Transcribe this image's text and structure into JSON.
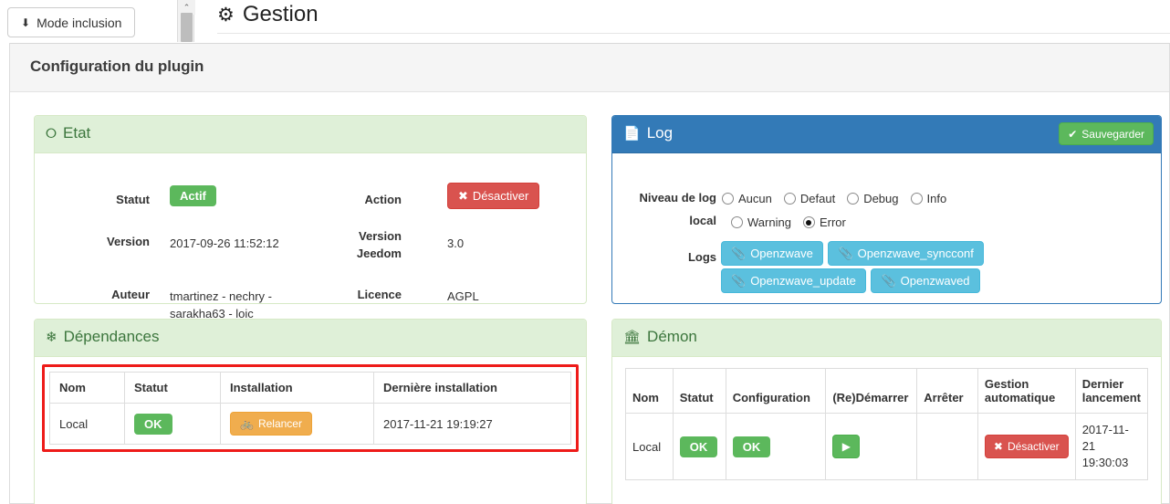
{
  "topbar": {
    "mode_button_label": "Mode inclusion",
    "mode_button_icon": "download-icon",
    "page_heading": "Gestion",
    "page_heading_icon": "gear-icon",
    "scrollbar_arrow": "⌃"
  },
  "panel": {
    "title": "Configuration du plugin"
  },
  "etat": {
    "title": "Etat",
    "icon": "power-circle-icon",
    "labels": {
      "statut": "Statut",
      "action": "Action",
      "version": "Version",
      "version_jeedom": "Version Jeedom",
      "auteur": "Auteur",
      "licence": "Licence"
    },
    "statut_value": "Actif",
    "action_button": "Désactiver",
    "action_button_icon": "times-icon",
    "version_value": "2017-09-26 11:52:12",
    "version_jeedom_value": "3.0",
    "auteur_value": "tmartinez - nechry - sarakha63 - loic",
    "licence_value": "AGPL"
  },
  "log": {
    "title": "Log",
    "icon": "file-icon",
    "save_button": "Sauvegarder",
    "save_button_icon": "check-circle-icon",
    "level_label": "Niveau de log local",
    "levels": [
      {
        "label": "Aucun",
        "checked": false
      },
      {
        "label": "Defaut",
        "checked": false
      },
      {
        "label": "Debug",
        "checked": false
      },
      {
        "label": "Info",
        "checked": false
      },
      {
        "label": "Warning",
        "checked": false
      },
      {
        "label": "Error",
        "checked": true
      }
    ],
    "logs_label": "Logs",
    "log_buttons": [
      "Openzwave",
      "Openzwave_syncconf",
      "Openzwave_update",
      "Openzwaved"
    ],
    "log_button_icon": "paperclip-icon"
  },
  "dependances": {
    "title": "Dépendances",
    "icon": "cubes-icon",
    "columns": [
      "Nom",
      "Statut",
      "Installation",
      "Dernière installation"
    ],
    "rows": [
      {
        "nom": "Local",
        "statut": "OK",
        "installation": "Relancer",
        "installation_icon": "bicycle-icon",
        "derniere_installation": "2017-11-21 19:19:27"
      }
    ],
    "highlighted": true,
    "highlight_color": "#ee1b19"
  },
  "demon": {
    "title": "Démon",
    "icon": "bank-icon",
    "columns": [
      "Nom",
      "Statut",
      "Configuration",
      "(Re)Démarrer",
      "Arrêter",
      "Gestion automatique",
      "Dernier lancement"
    ],
    "rows": [
      {
        "nom": "Local",
        "statut": "OK",
        "configuration": "OK",
        "redemarrer_icon": "play-icon",
        "arreter": "",
        "gestion_automatique": "Désactiver",
        "gestion_automatique_icon": "times-icon",
        "dernier_lancement": "2017-11-21 19:30:03"
      }
    ]
  },
  "colors": {
    "brand_blue": "#337ab7",
    "success_green": "#5cb85c",
    "panel_green_bg": "#dff0d8",
    "panel_green_text": "#3c763d",
    "danger_red": "#d9534f",
    "warning_orange": "#f0ad4e",
    "info_blue": "#5bc0de",
    "highlight_red": "#ee1b19"
  }
}
